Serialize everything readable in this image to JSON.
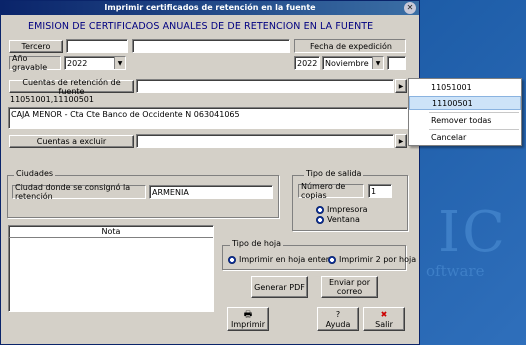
{
  "window": {
    "title": "Imprimir certificados de retención  en la fuente"
  },
  "header": {
    "title": "EMISION DE CERTIFICADOS ANUALES DE DE RETENCION EN LA FUENTE"
  },
  "tercero": {
    "button": "Tercero",
    "code": "",
    "name": ""
  },
  "fecha": {
    "label": "Fecha de expedición",
    "year": "2022",
    "month": "Noviembre",
    "day": ""
  },
  "ano": {
    "label": "Año gravable",
    "value": "2022"
  },
  "cuentas_ret": {
    "button": "Cuentas de retención de fuente",
    "value": "",
    "selected": "11051001,11100501"
  },
  "caja": {
    "value": "CAJA MENOR - Cta Cte Banco de Occidente N 063041065"
  },
  "cuentas_exc": {
    "button": "Cuentas a excluir",
    "value": ""
  },
  "ciudades": {
    "title": "Ciudades",
    "label": "Ciudad donde se consignó la retención",
    "value": "ARMENIA"
  },
  "salida": {
    "title": "Tipo de salida",
    "copies_label": "Número de copias",
    "copies": "1",
    "opt1": "Impresora",
    "opt2": "Ventana"
  },
  "nota": {
    "header": "Nota"
  },
  "hoja": {
    "title": "Tipo de hoja",
    "opt1": "Imprimir en hoja entera",
    "opt2": "Imprimir 2 por hoja"
  },
  "buttons": {
    "pdf": "Generar PDF",
    "email": "Enviar por correo",
    "print": "Imprimir",
    "help": "Ayuda",
    "exit": "Salir"
  },
  "context_menu": {
    "items": [
      "11051001",
      "11100501",
      "Remover todas",
      "Cancelar"
    ]
  },
  "background": {
    "logo": "IC",
    "tagline": "oftware"
  }
}
